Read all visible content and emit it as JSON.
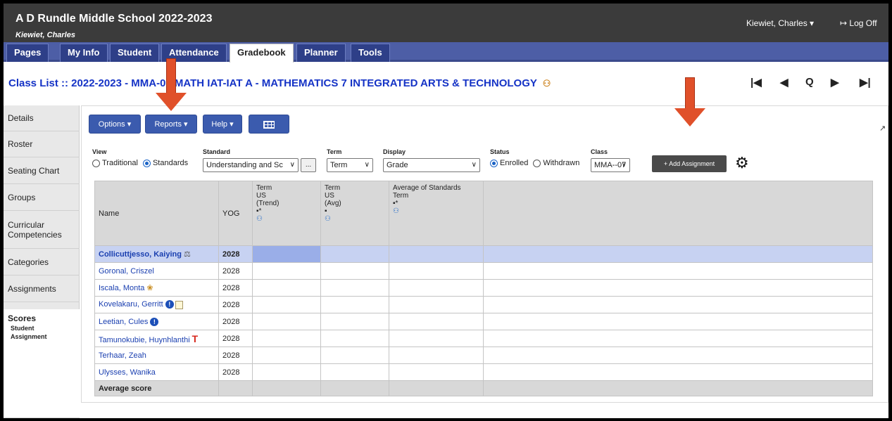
{
  "header": {
    "school": "A D Rundle Middle School 2022-2023",
    "teacher": "Kiewiet, Charles",
    "user_menu": "Kiewiet, Charles ▾",
    "logoff": "Log Off"
  },
  "nav": {
    "tabs": [
      "Pages",
      "My Info",
      "Student",
      "Attendance",
      "Gradebook",
      "Planner",
      "Tools"
    ],
    "active_tab": "Gradebook"
  },
  "page": {
    "title": "Class List :: 2022-2023 - MMA-07 MATH IAT-IAT A - MATHEMATICS 7 INTEGRATED ARTS & TECHNOLOGY",
    "pager": {
      "first": "|◀",
      "prev": "◀",
      "search": "Q",
      "next": "▶",
      "last": "▶|"
    }
  },
  "sidebar": {
    "items": [
      "Details",
      "Roster",
      "Seating Chart",
      "Groups",
      "Curricular Competencies",
      "Categories",
      "Assignments",
      "Scores"
    ],
    "active": "Scores",
    "sub_items": [
      "Student",
      "Assignment"
    ]
  },
  "toolbar": {
    "options": "Options ▾",
    "reports": "Reports ▾",
    "help": "Help ▾"
  },
  "filters": {
    "view_label": "View",
    "view_options": [
      "Traditional",
      "Standards"
    ],
    "view_selected": "Standards",
    "standard_label": "Standard",
    "standard_value": "Understanding and Sc",
    "standard_more": "...",
    "term_label": "Term",
    "term_value": "Term",
    "display_label": "Display",
    "display_value": "Grade",
    "status_label": "Status",
    "status_options": [
      "Enrolled",
      "Withdrawn"
    ],
    "status_selected": "Enrolled",
    "class_label": "Class",
    "class_value": "MMA--07",
    "add_assignment": "+ Add Assignment"
  },
  "grid": {
    "headers": {
      "name": "Name",
      "yog": "YOG",
      "col1": [
        "Term",
        "US",
        "(Trend)",
        "▪*"
      ],
      "col2": [
        "Term",
        "US",
        "(Avg)",
        "▪"
      ],
      "col3": [
        "Average of Standards",
        "Term",
        "▪*"
      ]
    },
    "rows": [
      {
        "name": "Collicuttjesso, Kaiying",
        "yog": "2028",
        "icon": "scales-icon"
      },
      {
        "name": "Goronal, Criszel",
        "yog": "2028",
        "icon": ""
      },
      {
        "name": "Iscala, Monta",
        "yog": "2028",
        "icon": "palette-icon"
      },
      {
        "name": "Kovelakaru, Gerritt",
        "yog": "2028",
        "icon": "info-note-icons"
      },
      {
        "name": "Leetian, Cules",
        "yog": "2028",
        "icon": "info-icon"
      },
      {
        "name": "Tamunokubie, Huynhlanthi",
        "yog": "2028",
        "icon": "t-icon"
      },
      {
        "name": "Terhaar, Zeah",
        "yog": "2028",
        "icon": ""
      },
      {
        "name": "Ulysses, Wanika",
        "yog": "2028",
        "icon": ""
      }
    ],
    "footer": "Average score"
  },
  "colors": {
    "header_bg": "#3b3b3b",
    "nav_bg": "#4d5ea6",
    "title_blue": "#1533c6",
    "arrow": "#e0502a"
  }
}
